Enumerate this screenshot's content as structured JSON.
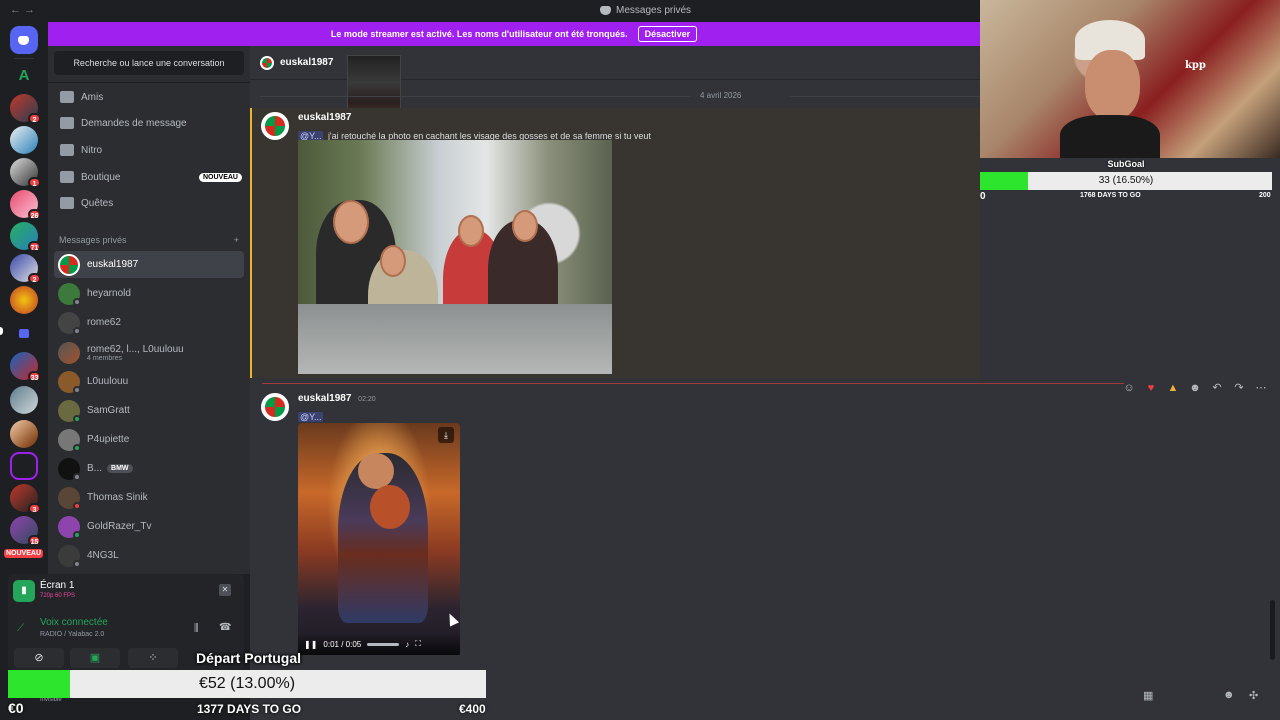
{
  "titlebar": {
    "nav": "←  →",
    "title": "Messages privés"
  },
  "banner": {
    "text": "Le mode streamer est activé. Les noms d'utilisateur ont été tronqués.",
    "button": "Désactiver"
  },
  "rail": {
    "badges": [
      "2",
      "1",
      "26",
      "71",
      "2",
      "33",
      "3",
      "15"
    ],
    "new_label": "NOUVEAU"
  },
  "dm": {
    "search": "Recherche ou lance une conversation",
    "nav": [
      {
        "label": "Amis",
        "icon": "friends-icon"
      },
      {
        "label": "Demandes de message",
        "icon": "mail-icon"
      },
      {
        "label": "Nitro",
        "icon": "nitro-icon"
      },
      {
        "label": "Boutique",
        "icon": "shop-icon",
        "badge": "NOUVEAU"
      },
      {
        "label": "Quêtes",
        "icon": "quests-icon"
      }
    ],
    "header": "Messages privés",
    "header_add": "+",
    "items": [
      {
        "name": "euskal1987"
      },
      {
        "name": "heyarnold"
      },
      {
        "name": "rome62"
      },
      {
        "name": "rome62, l..., L0uulouu",
        "sub": "4 membres"
      },
      {
        "name": "L0uulouu"
      },
      {
        "name": "SamGratt"
      },
      {
        "name": "P4upiette"
      },
      {
        "name": "B...",
        "badge": "BMW"
      },
      {
        "name": "Thomas Sinik"
      },
      {
        "name": "GoldRazer_Tv"
      },
      {
        "name": "4NG3L"
      }
    ]
  },
  "panel": {
    "screen_title": "Écran 1",
    "screen_sub": "720p 60 FPS",
    "voice_title": "Voix connectée",
    "voice_sub": "RADIO / Yalabac 2.0",
    "status": "Invisible"
  },
  "chat": {
    "header_name": "euskal1987",
    "date": "4 avril 2026",
    "messages": [
      {
        "author": "euskal1987",
        "mention": "@Y...",
        "text": "j'ai retouché la photo en cachant les visage des gosses et de sa femme si tu veut"
      },
      {
        "author": "euskal1987",
        "time": "02:20",
        "mention": "@Y..."
      }
    ],
    "video_time": "0:01 / 0:05"
  },
  "subgoal": {
    "title": "SubGoal",
    "value": "33 (16.50%)",
    "progress": 0.165,
    "min": "0",
    "days": "1768 DAYS TO GO",
    "max": "200"
  },
  "portugal_goal": {
    "title": "Départ Portugal",
    "value": "€52 (13.00%)",
    "progress": 0.13,
    "min": "€0",
    "days": "1377 DAYS TO GO",
    "max": "€400"
  },
  "cam": {
    "shirt_text": "kpp"
  },
  "colors": {
    "accent": "#a020f0",
    "goal_fill": "#2ee52e",
    "online": "#23a55a"
  }
}
